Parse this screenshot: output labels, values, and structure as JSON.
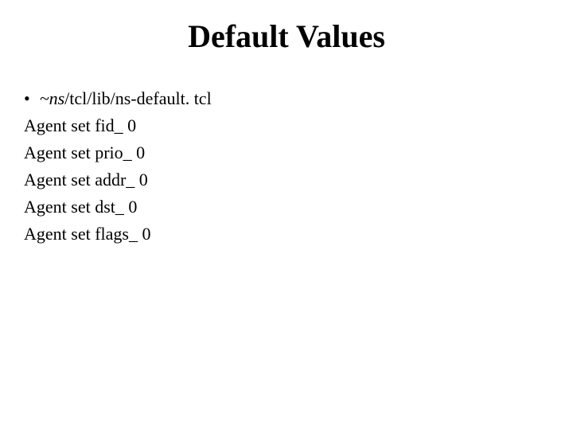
{
  "title": "Default Values",
  "bullet": {
    "prefix_italic": "~ns",
    "suffix": "/tcl/lib/ns-default. tcl"
  },
  "lines": [
    "Agent set fid_ 0",
    "Agent set prio_ 0",
    "Agent set addr_ 0",
    "Agent set dst_ 0",
    "Agent set flags_ 0"
  ]
}
